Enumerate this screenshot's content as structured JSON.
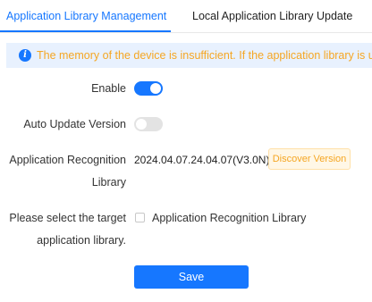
{
  "tabs": [
    {
      "label": "Application Library Management",
      "active": true
    },
    {
      "label": "Local Application Library Update",
      "active": false
    }
  ],
  "alert": {
    "icon": "info-icon",
    "text": "The memory of the device is insufficient. If the application library is updated, the device may restart."
  },
  "form": {
    "enable": {
      "label": "Enable",
      "value": true
    },
    "auto_update": {
      "label": "Auto Update Version",
      "value": false
    },
    "recognition": {
      "label_line1": "Application Recognition",
      "label_line2": "Library",
      "version": "2024.04.07.24.04.07(V3.0N)",
      "discover_button": "Discover Version"
    },
    "target": {
      "label_line1": "Please select the target",
      "label_line2": "application library.",
      "option": "Application Recognition Library",
      "checked": false
    },
    "save_button": "Save"
  },
  "colors": {
    "accent": "#1677ff",
    "warning": "#f5a623"
  }
}
